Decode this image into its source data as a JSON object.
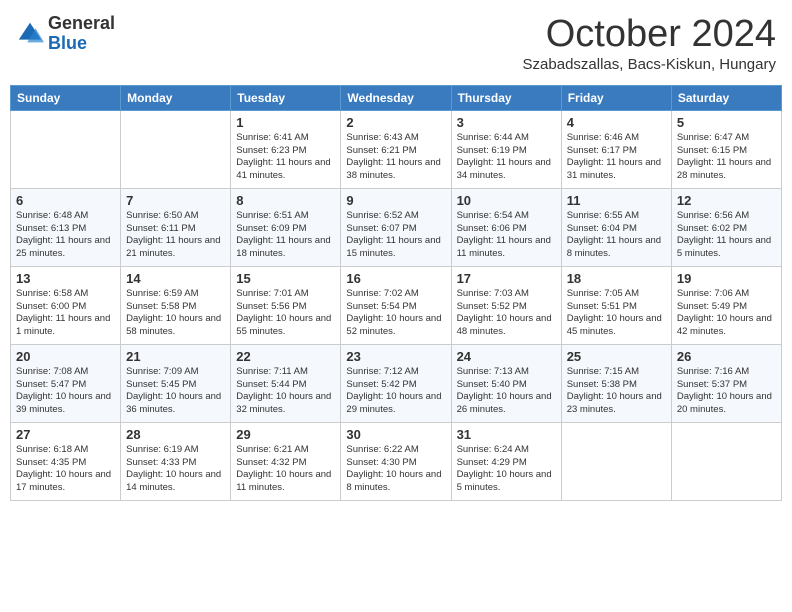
{
  "header": {
    "logo_general": "General",
    "logo_blue": "Blue",
    "month_title": "October 2024",
    "location": "Szabadszallas, Bacs-Kiskun, Hungary"
  },
  "days_of_week": [
    "Sunday",
    "Monday",
    "Tuesday",
    "Wednesday",
    "Thursday",
    "Friday",
    "Saturday"
  ],
  "weeks": [
    [
      {
        "day": "",
        "info": ""
      },
      {
        "day": "",
        "info": ""
      },
      {
        "day": "1",
        "info": "Sunrise: 6:41 AM\nSunset: 6:23 PM\nDaylight: 11 hours and 41 minutes."
      },
      {
        "day": "2",
        "info": "Sunrise: 6:43 AM\nSunset: 6:21 PM\nDaylight: 11 hours and 38 minutes."
      },
      {
        "day": "3",
        "info": "Sunrise: 6:44 AM\nSunset: 6:19 PM\nDaylight: 11 hours and 34 minutes."
      },
      {
        "day": "4",
        "info": "Sunrise: 6:46 AM\nSunset: 6:17 PM\nDaylight: 11 hours and 31 minutes."
      },
      {
        "day": "5",
        "info": "Sunrise: 6:47 AM\nSunset: 6:15 PM\nDaylight: 11 hours and 28 minutes."
      }
    ],
    [
      {
        "day": "6",
        "info": "Sunrise: 6:48 AM\nSunset: 6:13 PM\nDaylight: 11 hours and 25 minutes."
      },
      {
        "day": "7",
        "info": "Sunrise: 6:50 AM\nSunset: 6:11 PM\nDaylight: 11 hours and 21 minutes."
      },
      {
        "day": "8",
        "info": "Sunrise: 6:51 AM\nSunset: 6:09 PM\nDaylight: 11 hours and 18 minutes."
      },
      {
        "day": "9",
        "info": "Sunrise: 6:52 AM\nSunset: 6:07 PM\nDaylight: 11 hours and 15 minutes."
      },
      {
        "day": "10",
        "info": "Sunrise: 6:54 AM\nSunset: 6:06 PM\nDaylight: 11 hours and 11 minutes."
      },
      {
        "day": "11",
        "info": "Sunrise: 6:55 AM\nSunset: 6:04 PM\nDaylight: 11 hours and 8 minutes."
      },
      {
        "day": "12",
        "info": "Sunrise: 6:56 AM\nSunset: 6:02 PM\nDaylight: 11 hours and 5 minutes."
      }
    ],
    [
      {
        "day": "13",
        "info": "Sunrise: 6:58 AM\nSunset: 6:00 PM\nDaylight: 11 hours and 1 minute."
      },
      {
        "day": "14",
        "info": "Sunrise: 6:59 AM\nSunset: 5:58 PM\nDaylight: 10 hours and 58 minutes."
      },
      {
        "day": "15",
        "info": "Sunrise: 7:01 AM\nSunset: 5:56 PM\nDaylight: 10 hours and 55 minutes."
      },
      {
        "day": "16",
        "info": "Sunrise: 7:02 AM\nSunset: 5:54 PM\nDaylight: 10 hours and 52 minutes."
      },
      {
        "day": "17",
        "info": "Sunrise: 7:03 AM\nSunset: 5:52 PM\nDaylight: 10 hours and 48 minutes."
      },
      {
        "day": "18",
        "info": "Sunrise: 7:05 AM\nSunset: 5:51 PM\nDaylight: 10 hours and 45 minutes."
      },
      {
        "day": "19",
        "info": "Sunrise: 7:06 AM\nSunset: 5:49 PM\nDaylight: 10 hours and 42 minutes."
      }
    ],
    [
      {
        "day": "20",
        "info": "Sunrise: 7:08 AM\nSunset: 5:47 PM\nDaylight: 10 hours and 39 minutes."
      },
      {
        "day": "21",
        "info": "Sunrise: 7:09 AM\nSunset: 5:45 PM\nDaylight: 10 hours and 36 minutes."
      },
      {
        "day": "22",
        "info": "Sunrise: 7:11 AM\nSunset: 5:44 PM\nDaylight: 10 hours and 32 minutes."
      },
      {
        "day": "23",
        "info": "Sunrise: 7:12 AM\nSunset: 5:42 PM\nDaylight: 10 hours and 29 minutes."
      },
      {
        "day": "24",
        "info": "Sunrise: 7:13 AM\nSunset: 5:40 PM\nDaylight: 10 hours and 26 minutes."
      },
      {
        "day": "25",
        "info": "Sunrise: 7:15 AM\nSunset: 5:38 PM\nDaylight: 10 hours and 23 minutes."
      },
      {
        "day": "26",
        "info": "Sunrise: 7:16 AM\nSunset: 5:37 PM\nDaylight: 10 hours and 20 minutes."
      }
    ],
    [
      {
        "day": "27",
        "info": "Sunrise: 6:18 AM\nSunset: 4:35 PM\nDaylight: 10 hours and 17 minutes."
      },
      {
        "day": "28",
        "info": "Sunrise: 6:19 AM\nSunset: 4:33 PM\nDaylight: 10 hours and 14 minutes."
      },
      {
        "day": "29",
        "info": "Sunrise: 6:21 AM\nSunset: 4:32 PM\nDaylight: 10 hours and 11 minutes."
      },
      {
        "day": "30",
        "info": "Sunrise: 6:22 AM\nSunset: 4:30 PM\nDaylight: 10 hours and 8 minutes."
      },
      {
        "day": "31",
        "info": "Sunrise: 6:24 AM\nSunset: 4:29 PM\nDaylight: 10 hours and 5 minutes."
      },
      {
        "day": "",
        "info": ""
      },
      {
        "day": "",
        "info": ""
      }
    ]
  ]
}
